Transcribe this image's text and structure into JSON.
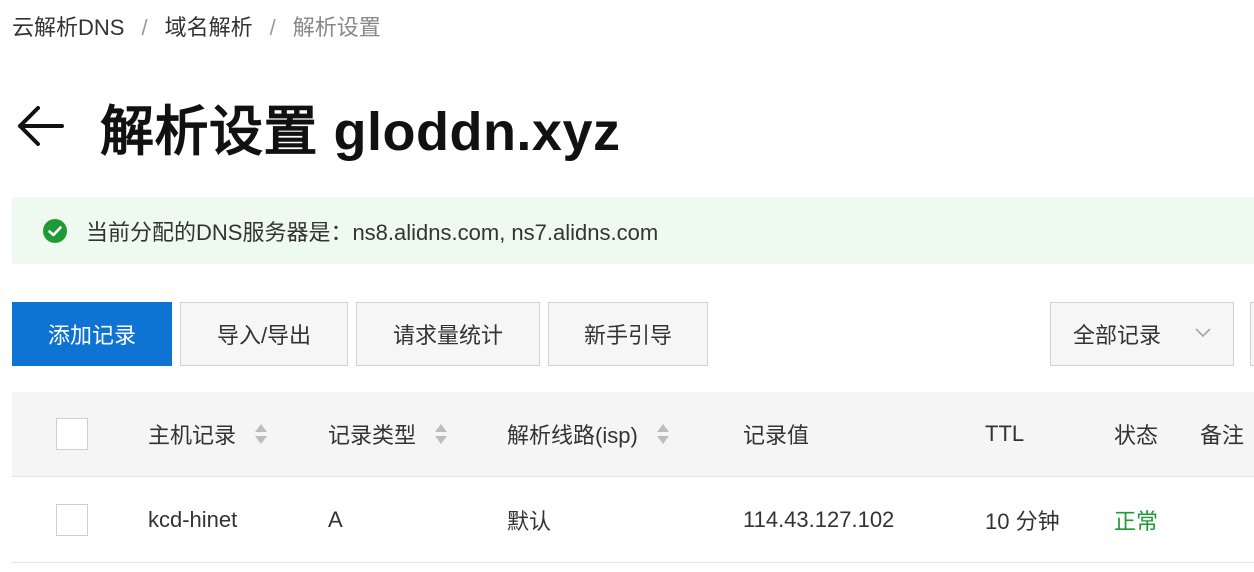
{
  "breadcrumb": {
    "items": [
      "云解析DNS",
      "域名解析",
      "解析设置"
    ],
    "separator": "/"
  },
  "page": {
    "title": "解析设置 gloddn.xyz"
  },
  "alert": {
    "text": "当前分配的DNS服务器是：ns8.alidns.com, ns7.alidns.com"
  },
  "toolbar": {
    "add_label": "添加记录",
    "import_export_label": "导入/导出",
    "stats_label": "请求量统计",
    "guide_label": "新手引导"
  },
  "filter": {
    "selected": "全部记录"
  },
  "table": {
    "columns": [
      "主机记录",
      "记录类型",
      "解析线路(isp)",
      "记录值",
      "TTL",
      "状态",
      "备注"
    ],
    "rows": [
      {
        "host": "kcd-hinet",
        "type": "A",
        "line": "默认",
        "value": "114.43.127.102",
        "ttl": "10 分钟",
        "status": "正常",
        "remark": ""
      }
    ]
  },
  "colors": {
    "primary": "#0d74d3",
    "success": "#1e9a36",
    "alert_bg": "#eef9ef"
  },
  "icons": {
    "back": "arrow-left-icon",
    "alert": "check-circle-icon",
    "filter": "chevron-down-icon",
    "sort": "sort-icon"
  }
}
